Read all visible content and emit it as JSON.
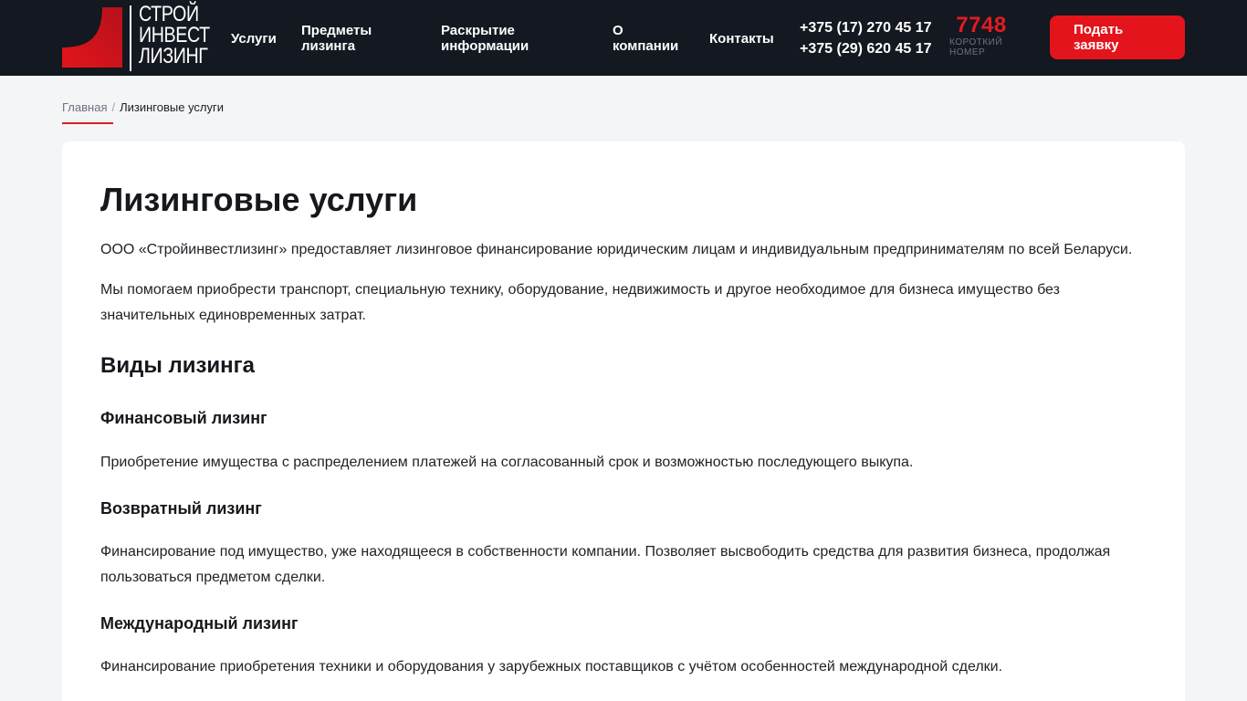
{
  "colors": {
    "accent": "#e3141b",
    "header_bg": "#141820",
    "page_bg": "#f4f5f7"
  },
  "logo": {
    "line1": "СТРОЙ",
    "line2": "ИНВЕСТ",
    "line3": "ЛИЗИНГ"
  },
  "nav": {
    "services": "Услуги",
    "subjects": "Предметы лизинга",
    "disclosure": "Раскрытие информации",
    "about": "О компании",
    "contacts": "Контакты"
  },
  "phones": [
    "+375 (17) 270 45 17",
    "+375 (29) 620 45 17"
  ],
  "short_number": {
    "value": "7748",
    "caption": "КОРОТКИЙ НОМЕР"
  },
  "cta": {
    "label": "Подать заявку"
  },
  "breadcrumb": {
    "home": "Главная",
    "separator": "/",
    "current": "Лизинговые услуги"
  },
  "content": {
    "title": "Лизинговые услуги",
    "intro1": "ООО «Стройинвестлизинг» предоставляет лизинговое финансирование юридическим лицам и индивидуальным предпринимателям по всей Беларуси.",
    "intro2": "Мы помогаем приобрести транспорт, специальную технику, оборудование, недвижимость и другое необходимое для бизнеса имущество без значительных единовременных затрат.",
    "types_heading": "Виды лизинга",
    "types": [
      {
        "title": "Финансовый лизинг",
        "text": "Приобретение имущества с распределением платежей на согласованный срок и возможностью последующего выкупа."
      },
      {
        "title": "Возвратный лизинг",
        "text": "Финансирование под имущество, уже находящееся в собственности компании. Позволяет высвободить средства для развития бизнеса, продолжая пользоваться предметом сделки."
      },
      {
        "title": "Международный лизинг",
        "text": "Финансирование приобретения техники и оборудования у зарубежных поставщиков с учётом особенностей международной сделки."
      }
    ]
  }
}
